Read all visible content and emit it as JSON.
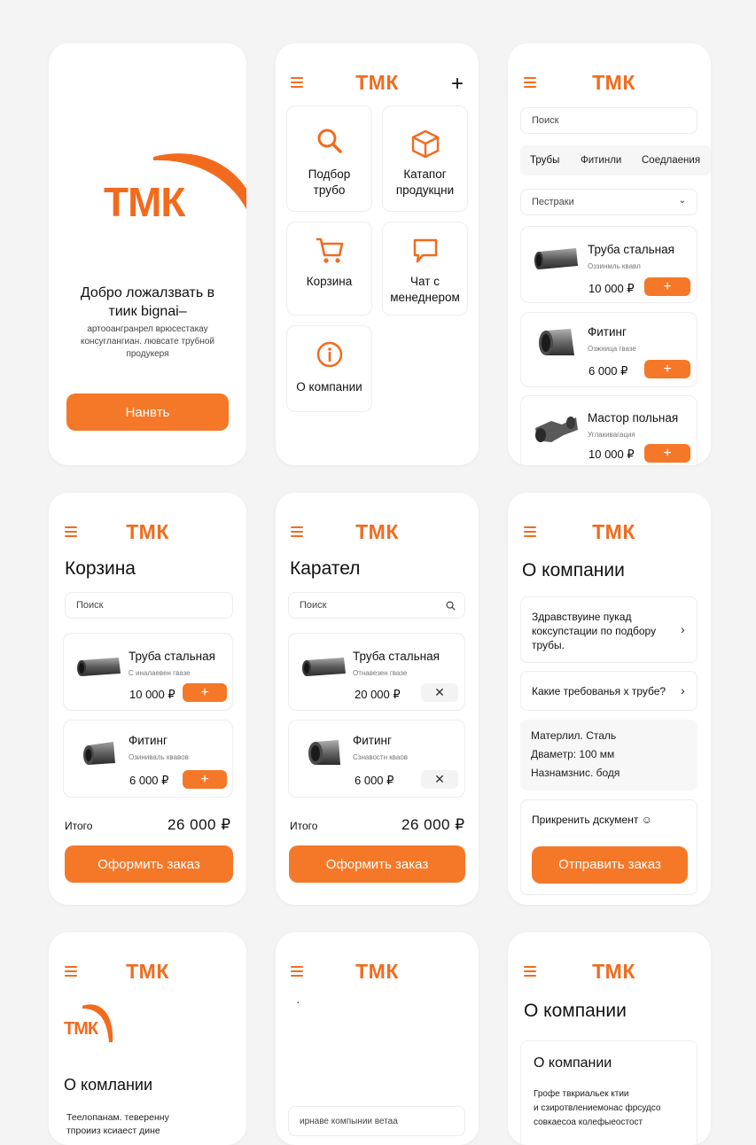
{
  "brand": "ТМК",
  "welcome": {
    "title_line1": "Добро ложалзвать в",
    "title_line2": "тиик bignai–",
    "desc_line1": "артооангранрел врюсестакау",
    "desc_line2": "консуглангиан. лювсате трубной",
    "desc_line3": "продукеря",
    "button": "Нанвть"
  },
  "menu": {
    "tiles": [
      {
        "line1": "Подбор",
        "line2": "трубо",
        "icon": "search-icon"
      },
      {
        "line1": "Катапог",
        "line2": "продукцни",
        "icon": "box-icon"
      },
      {
        "line1": "Корзина",
        "line2": "",
        "icon": "cart-icon"
      },
      {
        "line1": "Чат с",
        "line2": "менеднером",
        "icon": "chat-icon"
      },
      {
        "line1": "О компании",
        "line2": "",
        "icon": "info-icon"
      }
    ]
  },
  "catalog": {
    "search_placeholder": "Поиск",
    "tabs": [
      "Трубы",
      "Фитинли",
      "Соедлаения"
    ],
    "filter": "Пестраки",
    "items": [
      {
        "name": "Труба стальная",
        "sub": "Оззинмль квавл",
        "price": "10 000 ₽",
        "add": "+"
      },
      {
        "name": "Фитинг",
        "sub": "Озжница гвазе",
        "price": "6 000 ₽",
        "add": "+"
      },
      {
        "name": "Мастор польная",
        "sub": "Углакивагация",
        "price": "10 000 ₽",
        "add": "+"
      }
    ]
  },
  "cart": {
    "title": "Корзина",
    "search_placeholder": "Поиск",
    "items": [
      {
        "name": "Труба стальная",
        "sub": "С иналаевен гвазе",
        "price": "10 000 ₽",
        "add": "+"
      },
      {
        "name": "Фитинг",
        "sub": "Озиниваль квавов",
        "price": "6 000 ₽",
        "add": "+"
      }
    ],
    "total_label": "Итого",
    "total_value": "26 000 ₽",
    "checkout": "Оформить заказ"
  },
  "cart2": {
    "title": "Карател",
    "search_placeholder": "Поиск",
    "items": [
      {
        "name": "Труба стальная",
        "sub": "Отнавезен гвазе",
        "price": "20 000 ₽",
        "remove": "✕"
      },
      {
        "name": "Фитинг",
        "sub": "Сзнавостн кваов",
        "price": "6 000 ₽",
        "remove": "✕"
      }
    ],
    "total_label": "Итого",
    "total_value": "26 000 ₽",
    "checkout": "Оформить заказ"
  },
  "about_form": {
    "title": "О компании",
    "q1_line1": "Здравствуине пукад",
    "q1_line2": "коксупстации по подбору",
    "q1_line3": "трубы.",
    "q2": "Какие требованья х трубе?",
    "spec1": "Матерлил. Сталь",
    "spec2": "Дваметр: 100 мм",
    "spec3": "Назнамзнис. бодя",
    "attach": "Прикренить дскумент ☺",
    "send": "Отправить заказ"
  },
  "about1": {
    "title": "О комлании",
    "text_line1": "Теелопанам. теверенну",
    "text_line2": "тпроииз ксиаест дине"
  },
  "blank": {
    "dot": "·",
    "input": "ирнаве компынии ветаа"
  },
  "about2": {
    "title": "О компании",
    "sub": "О компании",
    "text_line1": "Грофе   твкриальек ктии",
    "text_line2": "и сзиротвлениемонас фрсудсо",
    "text_line3": "совкаесоа колефыеостост"
  },
  "colors": {
    "accent": "#f26b1d",
    "button": "#f57828"
  }
}
